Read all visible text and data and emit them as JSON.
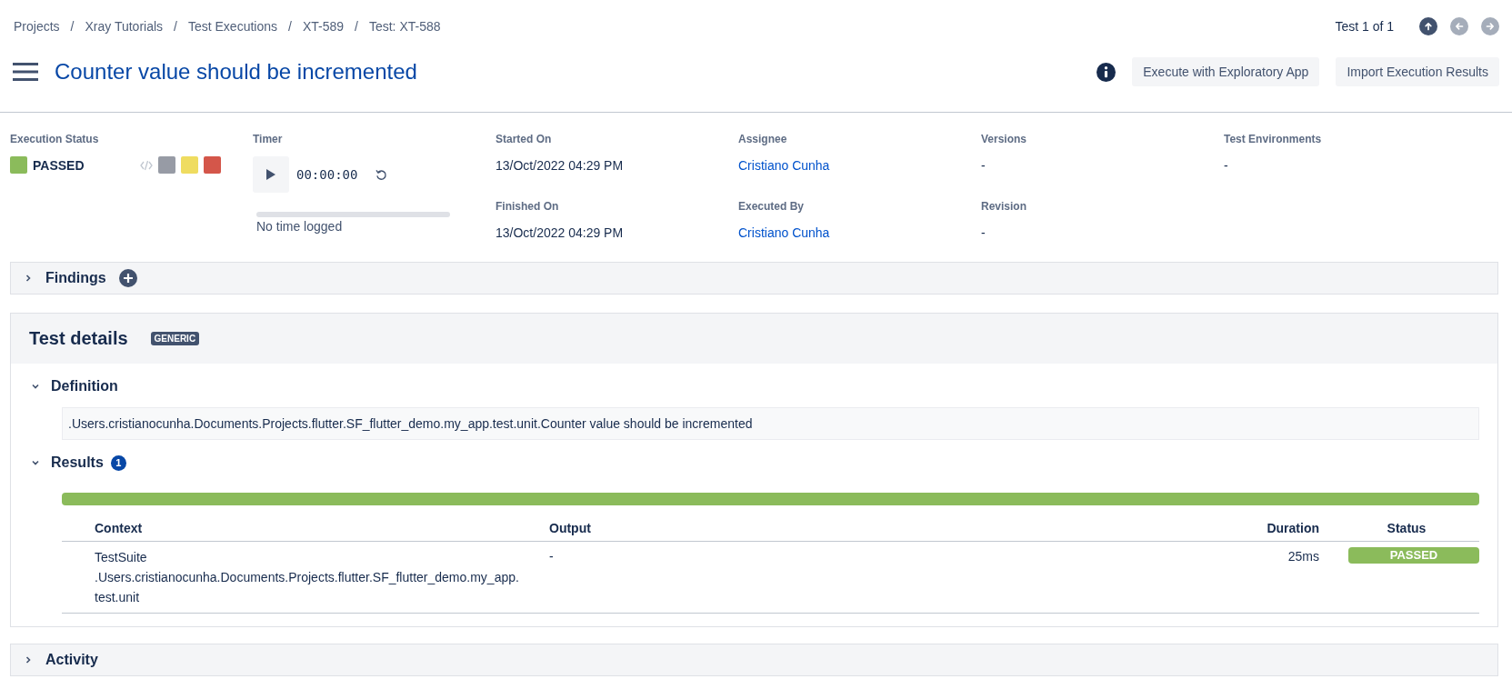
{
  "breadcrumbs": [
    "Projects",
    "Xray Tutorials",
    "Test Executions",
    "XT-589",
    "Test: XT-588"
  ],
  "breadcrumb_separators": [
    "/",
    "/",
    "/",
    "/"
  ],
  "pager": {
    "label": "Test 1 of 1",
    "buttons": [
      {
        "kind": "up",
        "disabled": false
      },
      {
        "kind": "prev",
        "disabled": true
      },
      {
        "kind": "next",
        "disabled": true
      }
    ]
  },
  "title": "Counter value should be incremented",
  "actions": [
    "Execute with Exploratory App",
    "Import Execution Results"
  ],
  "execution_status": {
    "label": "Execution Status",
    "value": "PASSED",
    "color": "#8bbb5b",
    "swatches": [
      {
        "color": "#979ba5"
      },
      {
        "color": "#efdc60"
      },
      {
        "color": "#d4564a"
      }
    ]
  },
  "timer": {
    "label": "Timer",
    "time": "00:00:00",
    "level": 0,
    "logged": "No time logged"
  },
  "fields": [
    {
      "label": "Started On",
      "value": "13/Oct/2022 04:29 PM",
      "kind": "text"
    },
    {
      "label": "Assignee",
      "value": "Cristiano Cunha",
      "kind": "link"
    },
    {
      "label": "Versions",
      "value": "-",
      "kind": "text"
    },
    {
      "label": "Test Environments",
      "value": "-",
      "kind": "text"
    },
    {
      "label": "Finished On",
      "value": "13/Oct/2022 04:29 PM",
      "kind": "text"
    },
    {
      "label": "Executed By",
      "value": "Cristiano Cunha",
      "kind": "link"
    },
    {
      "label": "Revision",
      "value": "-",
      "kind": "text"
    }
  ],
  "findings": {
    "title": "Findings",
    "expanded": false
  },
  "test_details": {
    "title": "Test details",
    "badge": "GENERIC",
    "definition": {
      "title": "Definition",
      "expanded": true,
      "text": ".Users.cristianocunha.Documents.Projects.flutter.SF_flutter_demo.my_app.test.unit.Counter value should be incremented"
    },
    "results": {
      "title": "Results",
      "expanded": true,
      "count": "1",
      "level": 1,
      "table": {
        "columns": [
          "Context",
          "Output",
          "Duration",
          "Status"
        ],
        "rows": [
          {
            "context": "TestSuite .Users.cristianocunha.Documents.Projects.flutter.SF_flutter_demo.my_app.test.unit",
            "output": "-",
            "duration": "25ms",
            "status": "PASSED",
            "color": "#8bbb5b"
          }
        ]
      }
    }
  },
  "activity": {
    "title": "Activity",
    "expanded": false
  }
}
